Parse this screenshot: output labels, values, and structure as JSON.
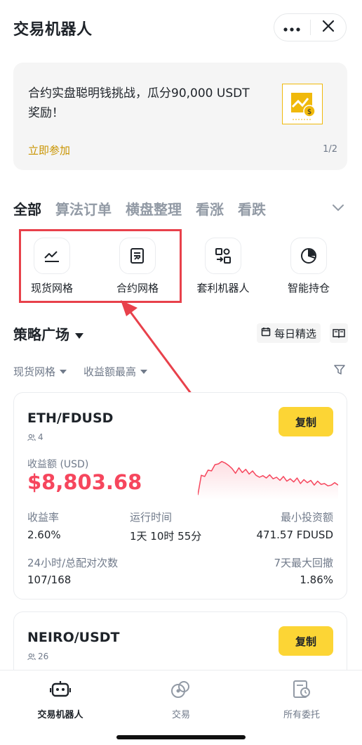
{
  "header": {
    "title": "交易机器人",
    "more_icon": "more-icon",
    "close_icon": "close-icon"
  },
  "banner": {
    "text": "合约实盘聪明钱挑战，瓜分90,000 USDT奖励！",
    "link": "立即参加",
    "page": "1/2",
    "accent": "#f0b90b"
  },
  "tabs": [
    "全部",
    "算法订单",
    "横盘整理",
    "看涨",
    "看跌"
  ],
  "bot_types": [
    {
      "label": "现货网格",
      "icon": "spot-grid-icon"
    },
    {
      "label": "合约网格",
      "icon": "futures-grid-icon"
    },
    {
      "label": "套利机器人",
      "icon": "arbitrage-icon"
    },
    {
      "label": "智能持仓",
      "icon": "pie-chart-icon"
    }
  ],
  "strategy": {
    "title": "策略广场",
    "daily_pick": "每日精选",
    "filter_type": "现货网格",
    "filter_sort": "收益额最高"
  },
  "cards": [
    {
      "pair": "ETH/FDUSD",
      "users": "4",
      "copy": "复制",
      "pnl_label": "收益额 (USD)",
      "pnl_value": "$8,803.68",
      "roi_label": "收益率",
      "roi_value": "2.60%",
      "runtime_label": "运行时间",
      "runtime_value": "1天 10时 55分",
      "min_label": "最小投资额",
      "min_value": "471.57 FDUSD",
      "matched_label": "24小时/总配对次数",
      "matched_value": "107/168",
      "mdd_label": "7天最大回撤",
      "mdd_value": "1.86%",
      "spark": [
        0.05,
        0.55,
        0.52,
        0.68,
        0.66,
        0.82,
        0.84,
        0.9,
        0.86,
        0.8,
        0.72,
        0.6,
        0.74,
        0.62,
        0.7,
        0.58,
        0.66,
        0.55,
        0.5,
        0.54,
        0.48,
        0.56,
        0.46,
        0.5,
        0.42,
        0.52,
        0.4,
        0.46,
        0.38,
        0.48,
        0.34,
        0.44,
        0.36,
        0.42,
        0.3,
        0.4,
        0.32,
        0.34,
        0.28,
        0.3,
        0.36,
        0.3
      ],
      "pnl_color": "#f6465d"
    },
    {
      "pair": "NEIRO/USDT",
      "users": "26",
      "copy": "复制"
    }
  ],
  "nav": [
    {
      "label": "交易机器人",
      "icon": "robot-icon",
      "active": true
    },
    {
      "label": "交易",
      "icon": "trade-icon",
      "active": false
    },
    {
      "label": "所有委托",
      "icon": "orders-icon",
      "active": false
    }
  ]
}
